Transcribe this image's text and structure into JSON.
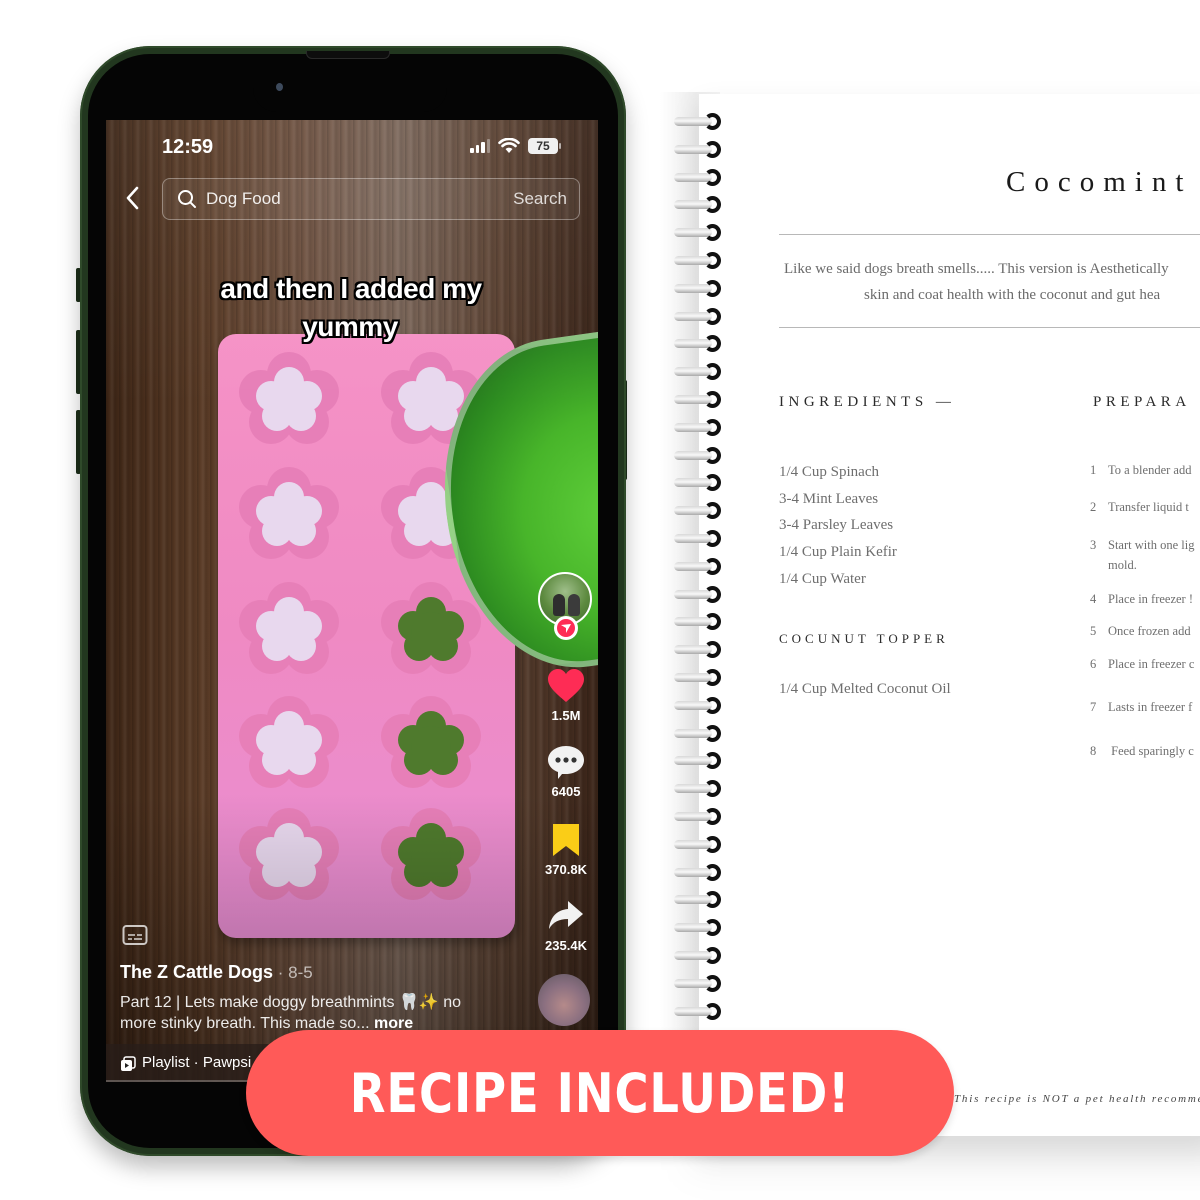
{
  "phone": {
    "status_bar": {
      "time": "12:59",
      "battery": "75",
      "icons": [
        "signal-icon",
        "wifi-icon",
        "battery-icon"
      ]
    },
    "search": {
      "back_icon": "chevron-left-icon",
      "icon": "search-icon",
      "query": "Dog Food",
      "button_label": "Search"
    },
    "video": {
      "caption_line1": "and then I added my",
      "caption_line2": "yummy"
    },
    "actions": {
      "likes": "1.5M",
      "comments": "6405",
      "saves": "370.8K",
      "shares": "235.4K",
      "like_color": "#fe2c55",
      "save_color": "#facd17"
    },
    "post": {
      "author": "The Z Cattle Dogs",
      "date": " · 8-5",
      "description": "Part 12 | Lets make doggy breathmints 🦷✨ no more stinky breath. This made so...",
      "more_label": " more",
      "playlist": "Playlist · Pawpsi"
    }
  },
  "notebook": {
    "title": "Cocomint",
    "intro_line1": "Like we said dogs breath smells..... This version is Aesthetically",
    "intro_line2": "skin and coat health with the coconut and gut hea",
    "ingredients_heading": "INGREDIENTS —",
    "ingredients": [
      "1/4 Cup Spinach",
      "3-4 Mint Leaves",
      "3-4 Parsley Leaves",
      "1/4 Cup Plain Kefir",
      "1/4 Cup Water"
    ],
    "topper_heading": "COCUNUT TOPPER",
    "topper_items": [
      "1/4 Cup Melted Coconut Oil"
    ],
    "preparation_heading": "PREPARA",
    "steps": [
      {
        "num": "1",
        "text": "To a blender add"
      },
      {
        "num": "2",
        "text": "Transfer liquid t"
      },
      {
        "num": "3",
        "text": "Start with one lig",
        "cont": "mold."
      },
      {
        "num": "4",
        "text": "Place in freezer !"
      },
      {
        "num": "5",
        "text": "Once frozen add"
      },
      {
        "num": "6",
        "text": "Place in freezer c"
      },
      {
        "num": "7",
        "text": "Lasts in freezer f"
      },
      {
        "num": "8",
        "text": " Feed sparingly c"
      }
    ],
    "disclaimer": "This recipe is NOT a pet health recomme"
  },
  "banner": {
    "text": "RECIPE INCLUDED!",
    "color": "#ff5a58"
  }
}
